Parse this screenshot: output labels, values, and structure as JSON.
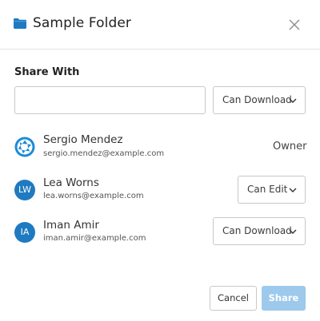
{
  "dialog": {
    "title": "Sample Folder",
    "icons": {
      "folder": "folder-icon",
      "close": "close-icon"
    }
  },
  "share": {
    "label": "Share With",
    "input_value": "",
    "input_placeholder": "",
    "permission_selected": "Can Download"
  },
  "users": [
    {
      "name": "Sergio Mendez",
      "email": "sergio.mendez@example.com",
      "avatar": "aperture-logo-icon",
      "role": "Owner"
    },
    {
      "name": "Lea Worns",
      "email": "lea.worns@example.com",
      "initials": "LW",
      "permission": "Can Edit"
    },
    {
      "name": "Iman Amir",
      "email": "iman.amir@example.com",
      "initials": "IA",
      "permission": "Can Download"
    }
  ],
  "footer": {
    "cancel_label": "Cancel",
    "share_label": "Share"
  },
  "colors": {
    "accent": "#1f7ac1",
    "share_disabled": "#9dc9ec",
    "border": "#c8c8c8"
  }
}
